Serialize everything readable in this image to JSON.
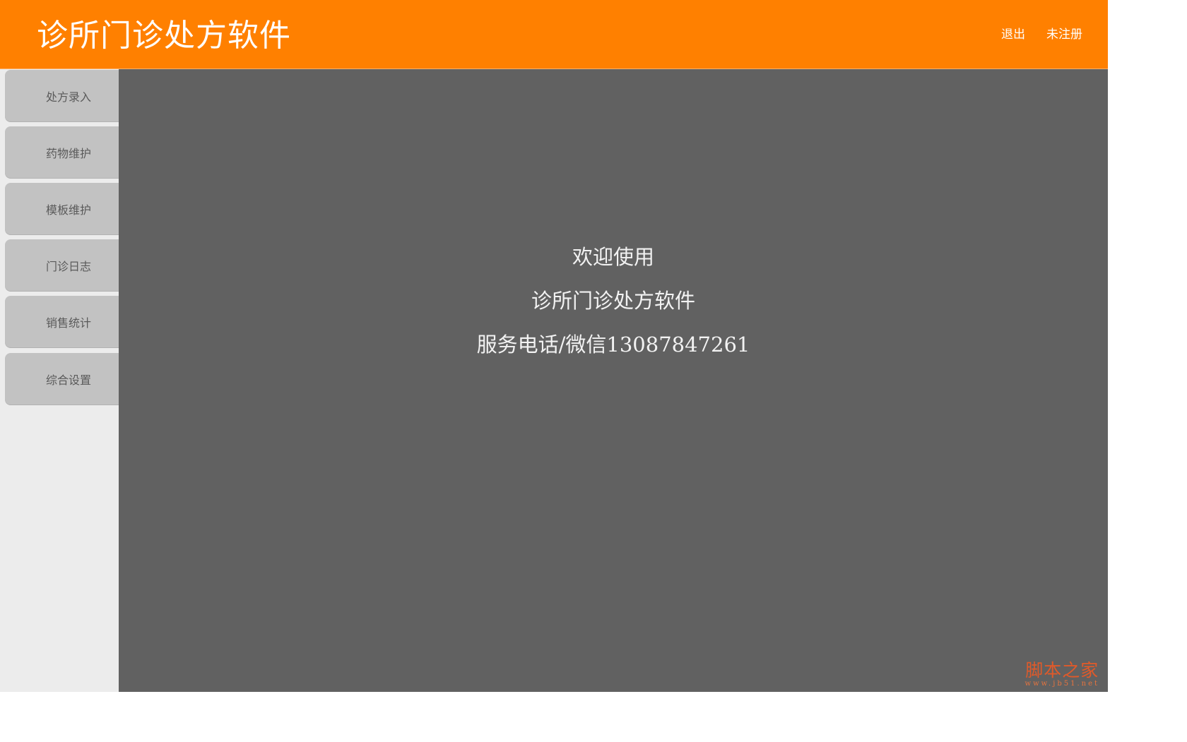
{
  "header": {
    "title": "诊所门诊处方软件",
    "logout_label": "退出",
    "register_label": "未注册"
  },
  "sidebar": {
    "items": [
      {
        "label": "处方录入"
      },
      {
        "label": "药物维护"
      },
      {
        "label": "模板维护"
      },
      {
        "label": "门诊日志"
      },
      {
        "label": "销售统计"
      },
      {
        "label": "综合设置"
      }
    ]
  },
  "main": {
    "welcome_line1": "欢迎使用",
    "welcome_line2": "诊所门诊处方软件",
    "welcome_line3": "服务电话/微信13087847261"
  },
  "watermark": {
    "text": "脚本之家",
    "url": "www.jb51.net"
  },
  "colors": {
    "header_bg": "#ff8000",
    "main_bg": "#616161",
    "sidebar_bg": "#ececec",
    "nav_item_bg": "#c2c2c2"
  }
}
